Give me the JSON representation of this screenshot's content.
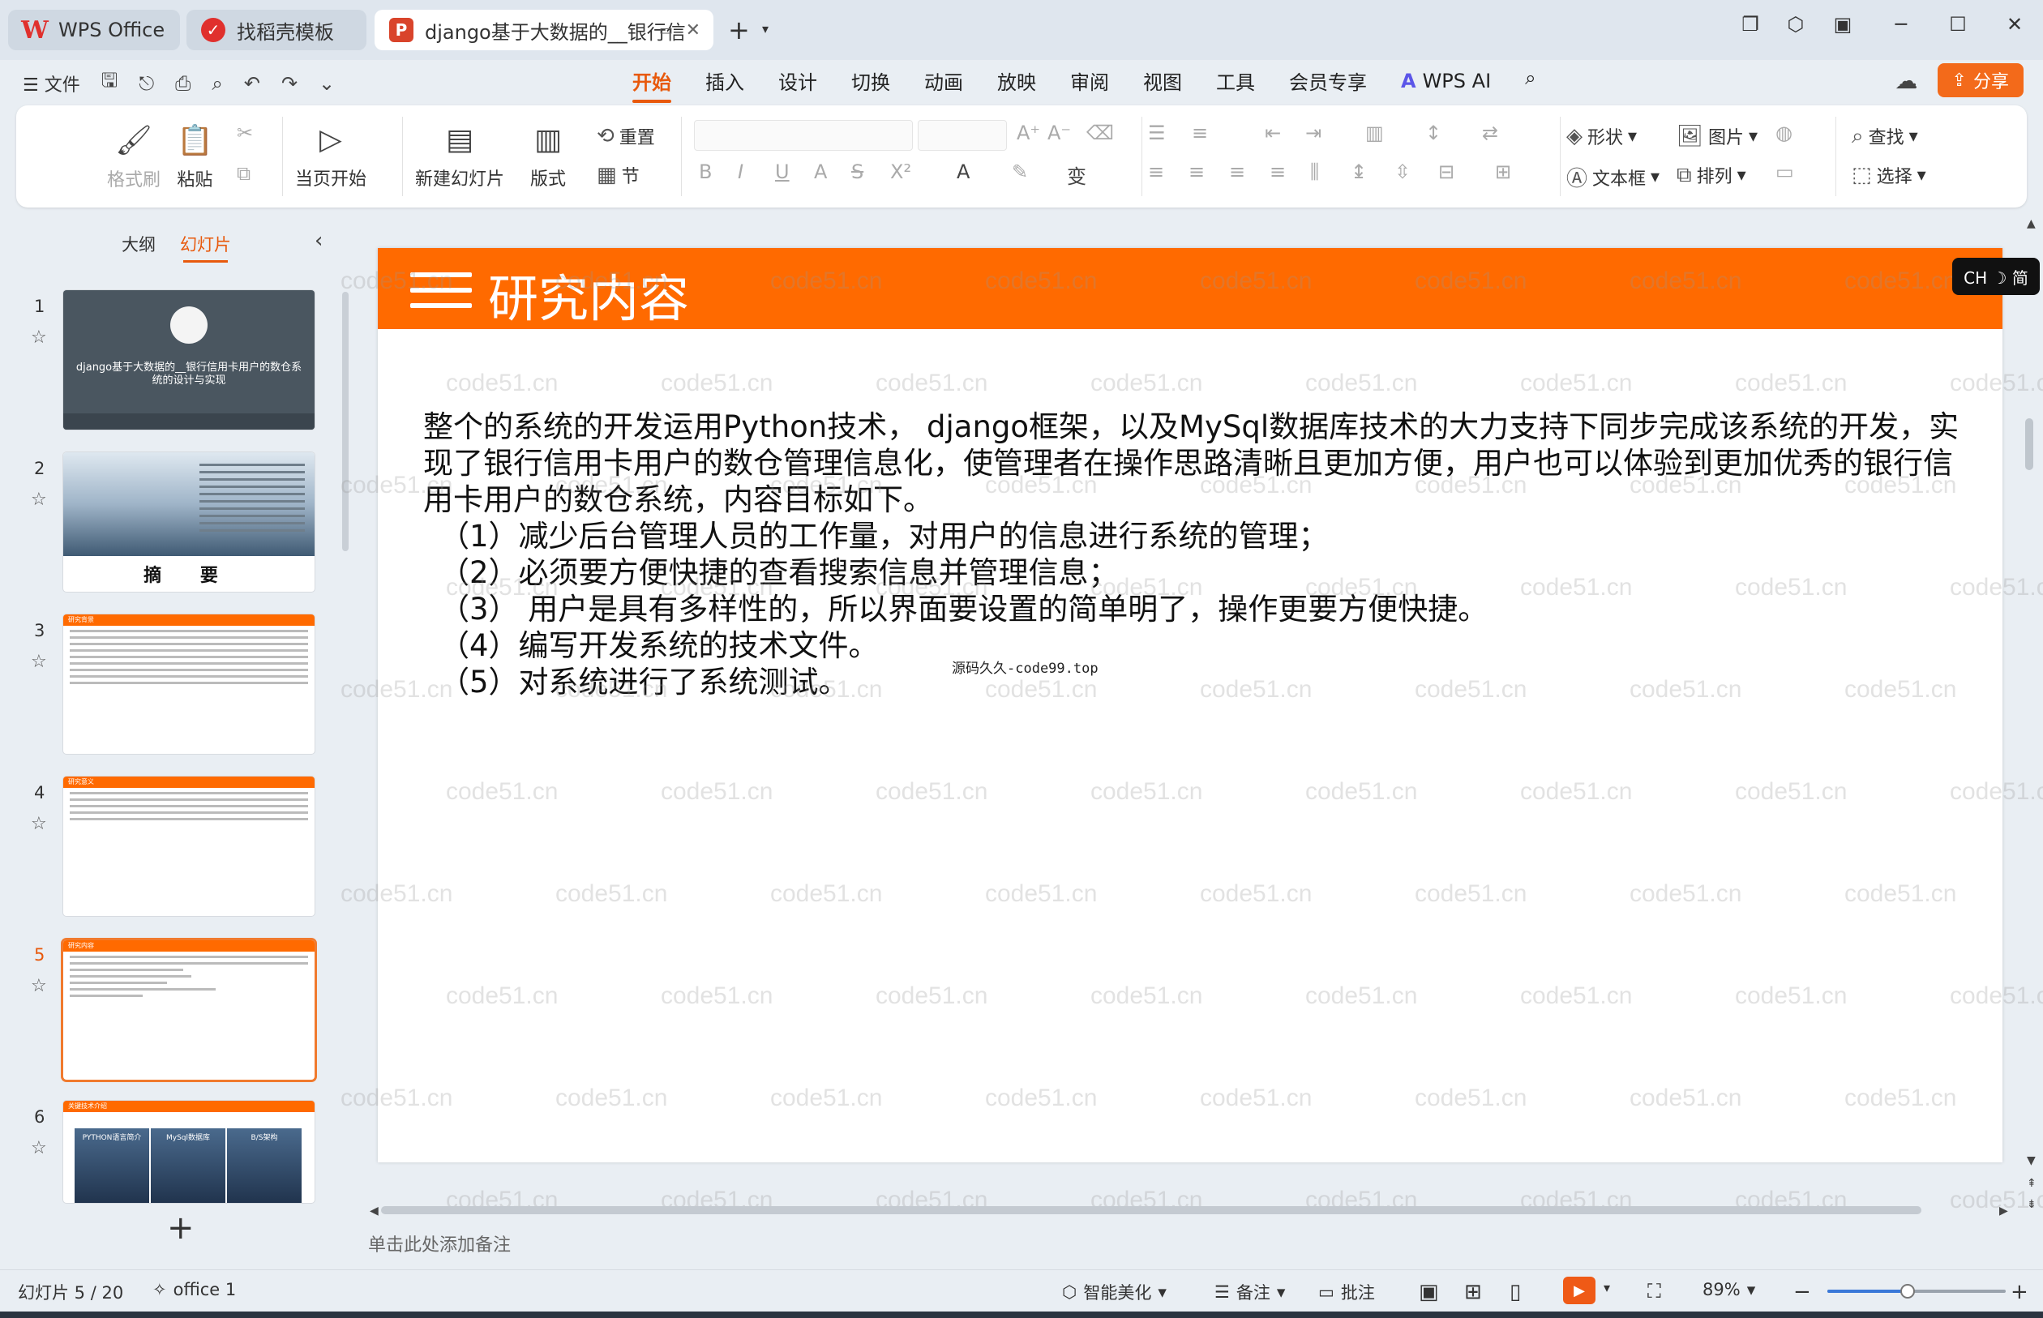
{
  "tabs": [
    {
      "label": "WPS Office"
    },
    {
      "label": "找稻壳模板"
    },
    {
      "label": "django基于大数据的__银行信"
    }
  ],
  "menu": {
    "file_label": "文件",
    "tabs": [
      "开始",
      "插入",
      "设计",
      "切换",
      "动画",
      "放映",
      "审阅",
      "视图",
      "工具",
      "会员专享"
    ],
    "active_tab": "开始",
    "wps_ai_label": "WPS AI",
    "share_label": "分享"
  },
  "ribbon": {
    "format_painter": "格式刷",
    "paste": "粘贴",
    "play_from_current": "当页开始",
    "new_slide": "新建幻灯片",
    "layout": "版式",
    "reset": "重置",
    "section": "节",
    "shape": "形状",
    "picture": "图片",
    "find": "查找",
    "textbox": "文本框",
    "arrange": "排列",
    "select": "选择"
  },
  "panel": {
    "outline_tab": "大纲",
    "slides_tab": "幻灯片",
    "thumbnails": [
      {
        "num": "1",
        "text": "django基于大数据的__银行信用卡用户的数仓系统的设计与实现"
      },
      {
        "num": "2",
        "label": "摘 要"
      },
      {
        "num": "3",
        "header": "研究背景"
      },
      {
        "num": "4",
        "header": "研究意义"
      },
      {
        "num": "5",
        "header": "研究内容"
      },
      {
        "num": "6",
        "header": "关键技术介绍",
        "pics": [
          "PYTHON语言简介",
          "MySql数据库",
          "B/S架构"
        ]
      }
    ]
  },
  "slide": {
    "title": "研究内容",
    "paragraph": "整个的系统的开发运用Python技术， django框架，以及MySql数据库技术的大力支持下同步完成该系统的开发，实现了银行信用卡用户的数仓管理信息化，使管理者在操作思路清晰且更加方便，用户也可以体验到更加优秀的银行信用卡用户的数仓系统，内容目标如下。",
    "items": [
      "（1）减少后台管理人员的工作量，对用户的信息进行系统的管理；",
      "（2）必须要方便快捷的查看搜索信息并管理信息；",
      "（3） 用户是具有多样性的，所以界面要设置的简单明了，操作更要方便快捷。",
      "（4）编写开发系统的技术文件。",
      "（5）对系统进行了系统测试。"
    ],
    "source_note": "源码久久-code99.top",
    "watermark": "code51.cn"
  },
  "ime_label": "CH ☽ 简",
  "notes_placeholder": "单击此处添加备注",
  "status": {
    "slide_counter": "幻灯片 5 / 20",
    "theme": "office 1",
    "beautify": "智能美化",
    "notes": "备注",
    "comments": "批注",
    "zoom": "89%",
    "zoom_fraction": 0.45
  },
  "colors": {
    "accent": "#ff6a00",
    "active_tab": "#e8590c",
    "share": "#f36a1a"
  }
}
